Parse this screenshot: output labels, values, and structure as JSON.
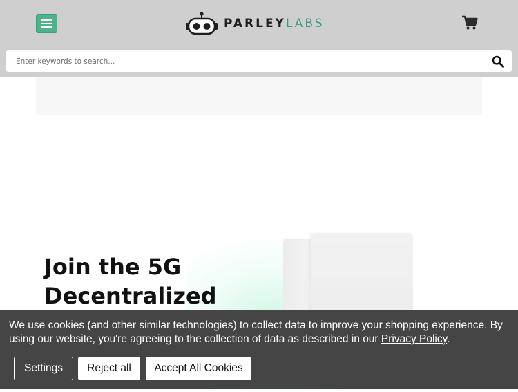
{
  "header": {
    "brand_bold": "PARLEY",
    "brand_light": "LABS",
    "menu_icon": "hamburger-menu-icon",
    "cart_icon": "shopping-cart-icon",
    "accent_color": "#4cb48a"
  },
  "search": {
    "placeholder": "Enter keywords to search...",
    "value": "",
    "icon": "search-icon"
  },
  "hero": {
    "title": "Join the 5G Decentralized"
  },
  "cookie_banner": {
    "text_before_link": "We use cookies (and other similar technologies) to collect data to improve your shopping experience. By using our website, you're agreeing to the collection of data as described in our ",
    "link_label": "Privacy Policy",
    "text_after_link": ".",
    "settings_label": "Settings",
    "reject_label": "Reject all",
    "accept_label": "Accept All Cookies"
  }
}
